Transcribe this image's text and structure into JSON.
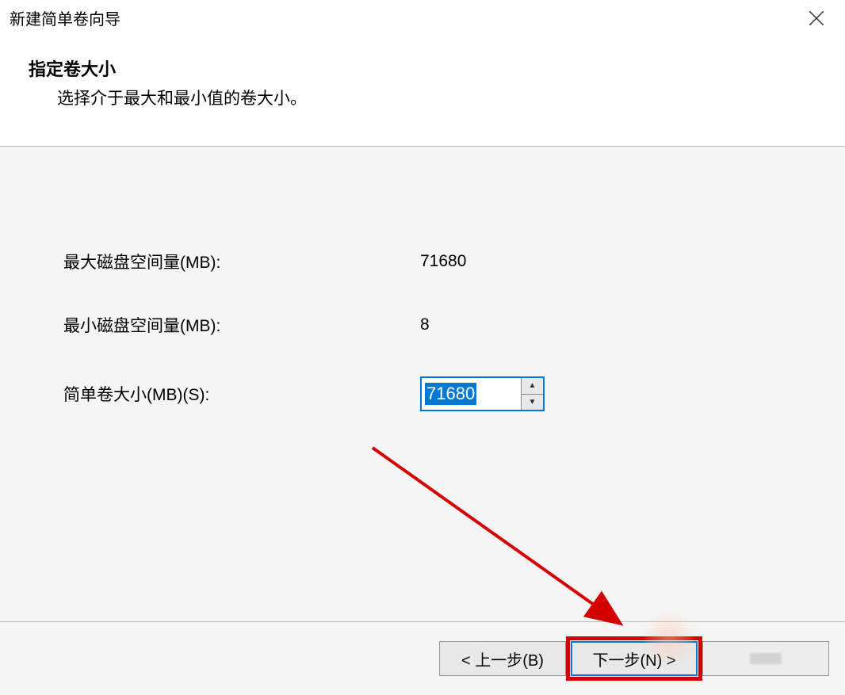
{
  "window": {
    "title": "新建简单卷向导"
  },
  "header": {
    "title": "指定卷大小",
    "description": "选择介于最大和最小值的卷大小。"
  },
  "fields": {
    "max_label": "最大磁盘空间量(MB):",
    "max_value": "71680",
    "min_label": "最小磁盘空间量(MB):",
    "min_value": "8",
    "size_label": "简单卷大小(MB)(S):",
    "size_value": "71680"
  },
  "buttons": {
    "back": "< 上一步(B)",
    "next": "下一步(N) >",
    "cancel": "取消"
  }
}
